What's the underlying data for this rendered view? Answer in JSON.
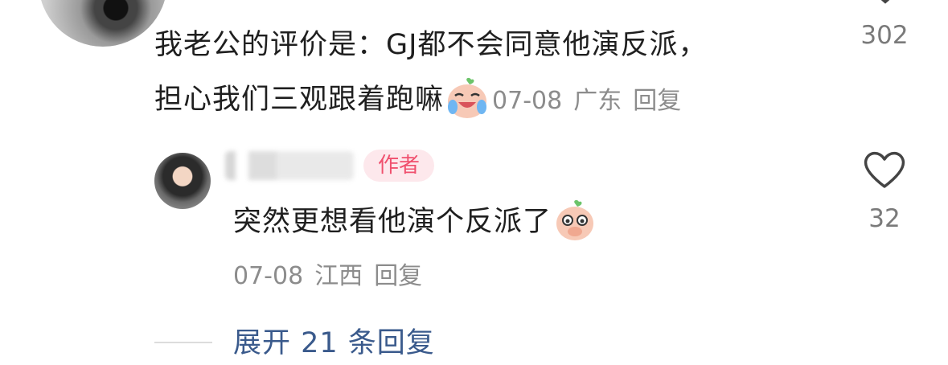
{
  "comment": {
    "text_line1": "我老公的评价是：GJ都不会同意他演反派，",
    "text_line2": "担心我们三观跟着跑嘛",
    "date": "07-08",
    "location": "广东",
    "reply_label": "回复",
    "like_count": "302",
    "emoji": "crying-laughing-peach-emoji"
  },
  "reply": {
    "author_tag": "作者",
    "text": "突然更想看他演个反派了",
    "date": "07-08",
    "location": "江西",
    "reply_label": "回复",
    "like_count": "32",
    "emoji": "shy-peach-emoji"
  },
  "expand": {
    "label": "展开 21 条回复"
  },
  "colors": {
    "text": "#1f1f1f",
    "meta": "#8c8c8c",
    "author_tag_bg": "#fde8ec",
    "author_tag_text": "#f0506e",
    "link": "#3a5a8c"
  }
}
